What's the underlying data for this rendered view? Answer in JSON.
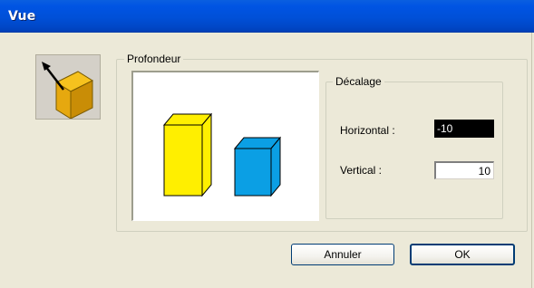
{
  "window": {
    "title": "Vue"
  },
  "depth_group": {
    "label": "Profondeur"
  },
  "offset_group": {
    "label": "Décalage"
  },
  "horizontal": {
    "label": "Horizontal :",
    "value": "-10"
  },
  "vertical": {
    "label": "Vertical :",
    "value": "10"
  },
  "buttons": {
    "cancel": "Annuler",
    "ok": "OK"
  },
  "colors": {
    "yellow_box": "#ffef00",
    "blue_box": "#0b9fe4",
    "titlebar": "#0054e3"
  }
}
